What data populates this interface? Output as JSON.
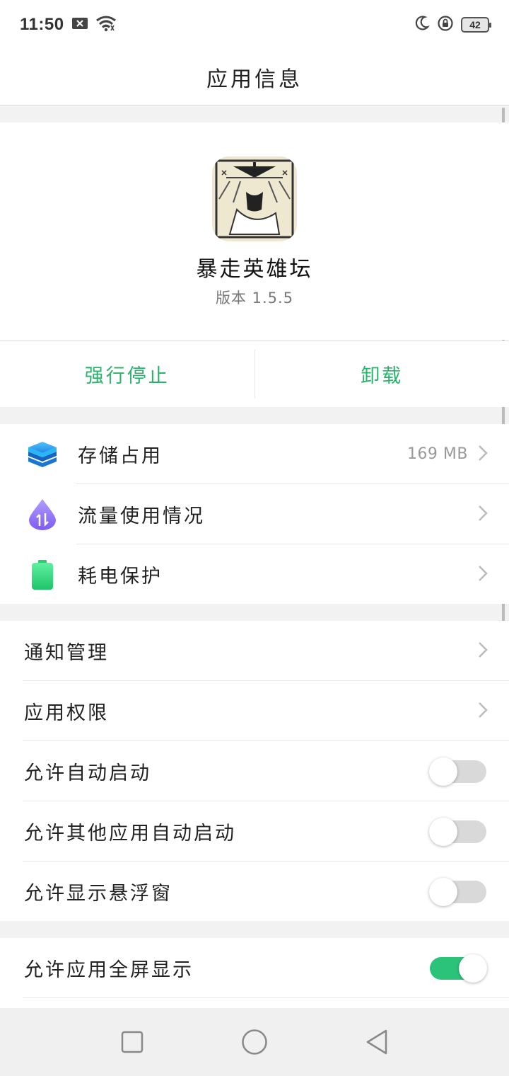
{
  "status": {
    "time": "11:50",
    "battery": "42"
  },
  "header": {
    "title": "应用信息"
  },
  "app": {
    "name": "暴走英雄坛",
    "version": "版本 1.5.5"
  },
  "actions": {
    "force_stop": "强行停止",
    "uninstall": "卸载"
  },
  "usage": [
    {
      "label": "存储占用",
      "value": "169 MB",
      "icon": "storage-icon"
    },
    {
      "label": "流量使用情况",
      "icon": "data-usage-icon"
    },
    {
      "label": "耗电保护",
      "icon": "battery-icon"
    }
  ],
  "settings": [
    {
      "label": "通知管理"
    },
    {
      "label": "应用权限"
    },
    {
      "label": "允许自动启动",
      "enabled": false
    },
    {
      "label": "允许其他应用自动启动",
      "enabled": false
    },
    {
      "label": "允许显示悬浮窗",
      "enabled": false
    }
  ],
  "display": [
    {
      "label": "允许应用全屏显示",
      "enabled": true
    }
  ],
  "colors": {
    "accent": "#2bb36b",
    "toggle_on": "#2bc37a"
  }
}
